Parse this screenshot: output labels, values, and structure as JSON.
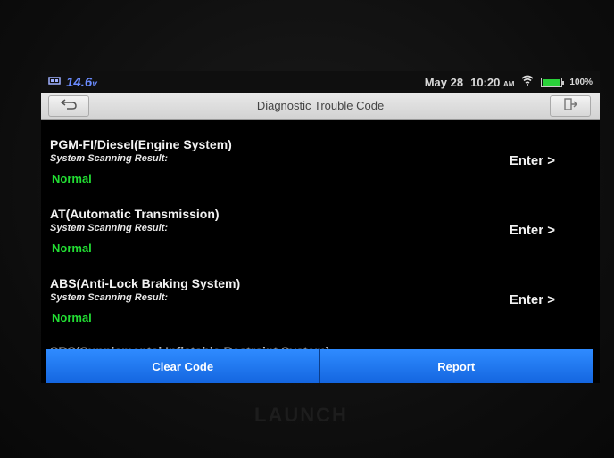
{
  "statusbar": {
    "voltage": "14.6",
    "voltage_unit": "v",
    "date": "May 28",
    "time": "10:20",
    "ampm": "AM",
    "battery_pct": "100%",
    "battery_level": 1.0,
    "icons": [
      "vehicle-icon",
      "wifi-icon",
      "battery-icon"
    ]
  },
  "titlebar": {
    "title": "Diagnostic Trouble Code",
    "back_icon": "back-arrow-icon",
    "exit_icon": "exit-icon"
  },
  "systems": [
    {
      "name": "PGM-FI/Diesel(Engine System)",
      "sub": "System Scanning Result:",
      "status": "Normal",
      "enter": "Enter >"
    },
    {
      "name": "AT(Automatic Transmission)",
      "sub": "System Scanning Result:",
      "status": "Normal",
      "enter": "Enter >"
    },
    {
      "name": "ABS(Anti-Lock Braking System)",
      "sub": "System Scanning Result:",
      "status": "Normal",
      "enter": "Enter >"
    }
  ],
  "partial_item": "SRS(Supplemental Inflatable Restraint System)",
  "buttons": {
    "clear": "Clear Code",
    "report": "Report"
  },
  "colors": {
    "status_normal": "#22dd33",
    "button_blue": "#1e78f0",
    "voltage_blue": "#6b8cff"
  },
  "brand": "LAUNCH"
}
